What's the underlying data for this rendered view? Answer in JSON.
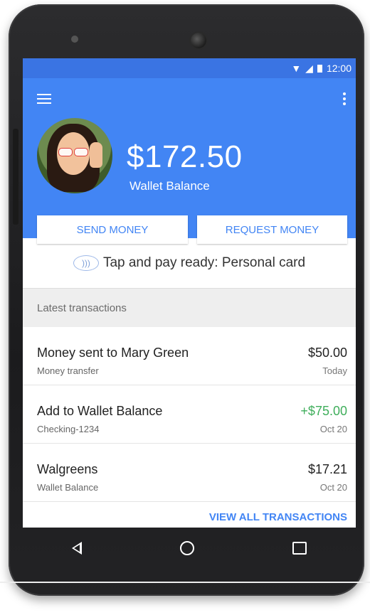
{
  "status_bar": {
    "time": "12:00"
  },
  "wallet": {
    "balance": "$172.50",
    "balance_label": "Wallet Balance",
    "send_label": "SEND MONEY",
    "request_label": "REQUEST MONEY",
    "tap_status": "Tap and pay ready: Personal card"
  },
  "transactions": {
    "section_title": "Latest transactions",
    "items": [
      {
        "title": "Money sent to Mary Green",
        "subtitle": "Money transfer",
        "amount": "$50.00",
        "date": "Today"
      },
      {
        "title": "Add to Wallet Balance",
        "subtitle": "Checking-1234",
        "amount": "+$75.00",
        "date": "Oct 20"
      },
      {
        "title": "Walgreens",
        "subtitle": "Wallet Balance",
        "amount": "$17.21",
        "date": "Oct 20"
      }
    ],
    "view_all_label": "VIEW ALL TRANSACTIONS"
  },
  "colors": {
    "primary": "#4285f4",
    "positive_amount": "#3fae5b"
  },
  "icons": [
    "wifi-icon",
    "signal-icon",
    "battery-icon",
    "menu-icon",
    "more-vert-icon",
    "nfc-icon",
    "back-icon",
    "home-icon",
    "recents-icon"
  ]
}
